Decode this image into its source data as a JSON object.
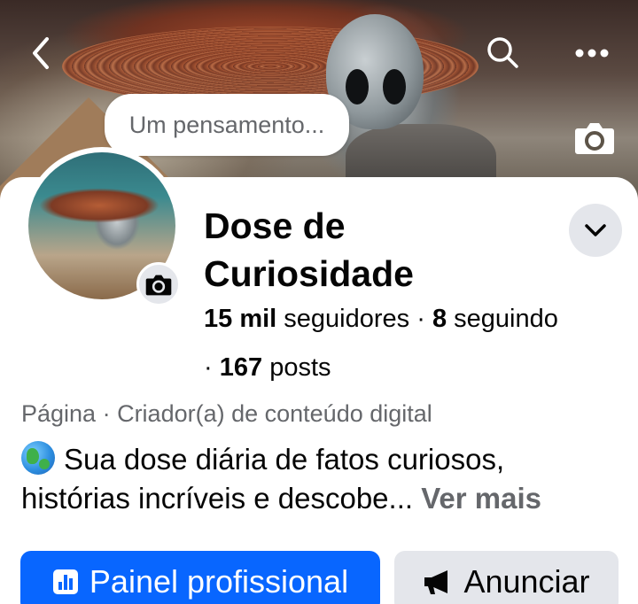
{
  "header": {
    "back_icon": "chevron-left-icon",
    "search_icon": "search-icon",
    "more_icon": "more-horizontal-icon",
    "cover_camera_icon": "camera-icon"
  },
  "profile": {
    "thought_placeholder": "Um pensamento...",
    "name": "Dose de Curiosidade",
    "avatar_camera_icon": "camera-icon",
    "dropdown_icon": "chevron-down-icon",
    "followers_count": "15 mil",
    "followers_label": "seguidores",
    "following_count": "8",
    "following_label": "seguindo",
    "posts_count": "167",
    "posts_label": "posts",
    "separator": "·",
    "category": "Página · Criador(a) de conteúdo digital",
    "bio_emoji": "🌎",
    "bio_line1": "Sua dose diária de fatos curiosos,",
    "bio_line2": "histórias incríveis e descobe...",
    "see_more": "Ver mais"
  },
  "actions": {
    "professional_dashboard": "Painel profissional",
    "advertise": "Anunciar",
    "dashboard_icon": "bar-chart-icon",
    "advertise_icon": "megaphone-icon"
  },
  "colors": {
    "primary": "#0866ff",
    "secondary_bg": "#e4e6eb",
    "muted_text": "#65676b",
    "text": "#050505"
  }
}
